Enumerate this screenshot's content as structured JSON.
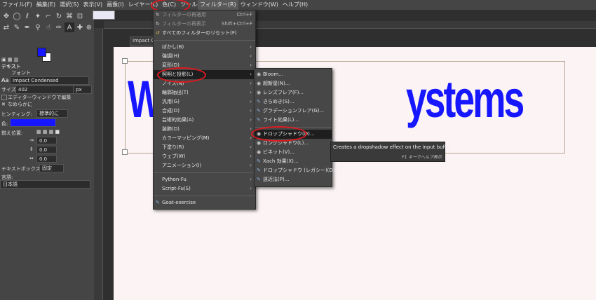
{
  "menubar": {
    "items": [
      "ファイル(F)",
      "編集(E)",
      "選択(S)",
      "表示(V)",
      "画像(I)",
      "レイヤー(L)",
      "色(C)",
      "ツール(T)",
      "フィルター(R)",
      "ウィンドウ(W)",
      "ヘルプ(H)"
    ],
    "active_label": "フィルター(R)"
  },
  "canvas": {
    "tab_title": "Impact C",
    "text_left": "W",
    "text_right": "ystems"
  },
  "toolbox": {
    "text_header": "テキスト",
    "font_label": "フォント",
    "font_value": "Impact Condensed",
    "size_label": "サイズ:",
    "size_value": "402",
    "size_unit": "px",
    "editor_label": "エディターウィンドウで編集",
    "antialias_label": "なめらかに",
    "hinting_label": "ヒンティング:",
    "hinting_value": "標準的に",
    "color_label": "色:",
    "color_value": "#1616ff",
    "justify_label": "揃え位置:",
    "indent": "0.0",
    "line_spacing": "0.0",
    "letter_spacing": "0.0",
    "box_label": "テキストボックス:",
    "box_value": "固定",
    "language_label": "言語:",
    "language_value": "日本語"
  },
  "filters_menu": {
    "reapply_label": "フィルターの再適用",
    "reapply_shortcut": "Ctrl+F",
    "reshow_label": "フィルターの再表示",
    "reshow_shortcut": "Shift+Ctrl+F",
    "reset_label": "すべてのフィルターのリセット(F)",
    "items": [
      "ぼかし(B)",
      "強調(H)",
      "変形(D)",
      "照明と投影(L)",
      "ノイズ(N)",
      "輪郭抽出(T)",
      "汎用(G)",
      "合成(O)",
      "芸術的効果(A)",
      "装飾(D)",
      "カラーマッピング(M)",
      "下塗り(R)",
      "ウェブ(W)",
      "アニメーション(I)"
    ],
    "python_fu": "Python-Fu",
    "script_fu": "Script-Fu(S)",
    "goat_exercise": "Goat-exercise"
  },
  "light_shadow_menu": {
    "items": [
      "Bloom...",
      "超新星(N)...",
      "レンズフレア(F)...",
      "きらめき(S)...",
      "グラデーションフレア(G)...",
      "ライト効果(L)..."
    ],
    "shadow_items": [
      "ドロップシャドウ(D)...",
      "ロングシャドウ(L)...",
      "ビネット(V)...",
      "Xach 効果(X)...",
      "ドロップシャドウ (レガシー)(D)...",
      "遠近法(P)..."
    ]
  },
  "tooltip": {
    "text": "Creates a dropshadow effect on the input buffer",
    "help": "F1 キーでヘルプ表示"
  },
  "colors": {
    "highlight_circle": "#e0191f",
    "text_blue": "#1616ff"
  }
}
